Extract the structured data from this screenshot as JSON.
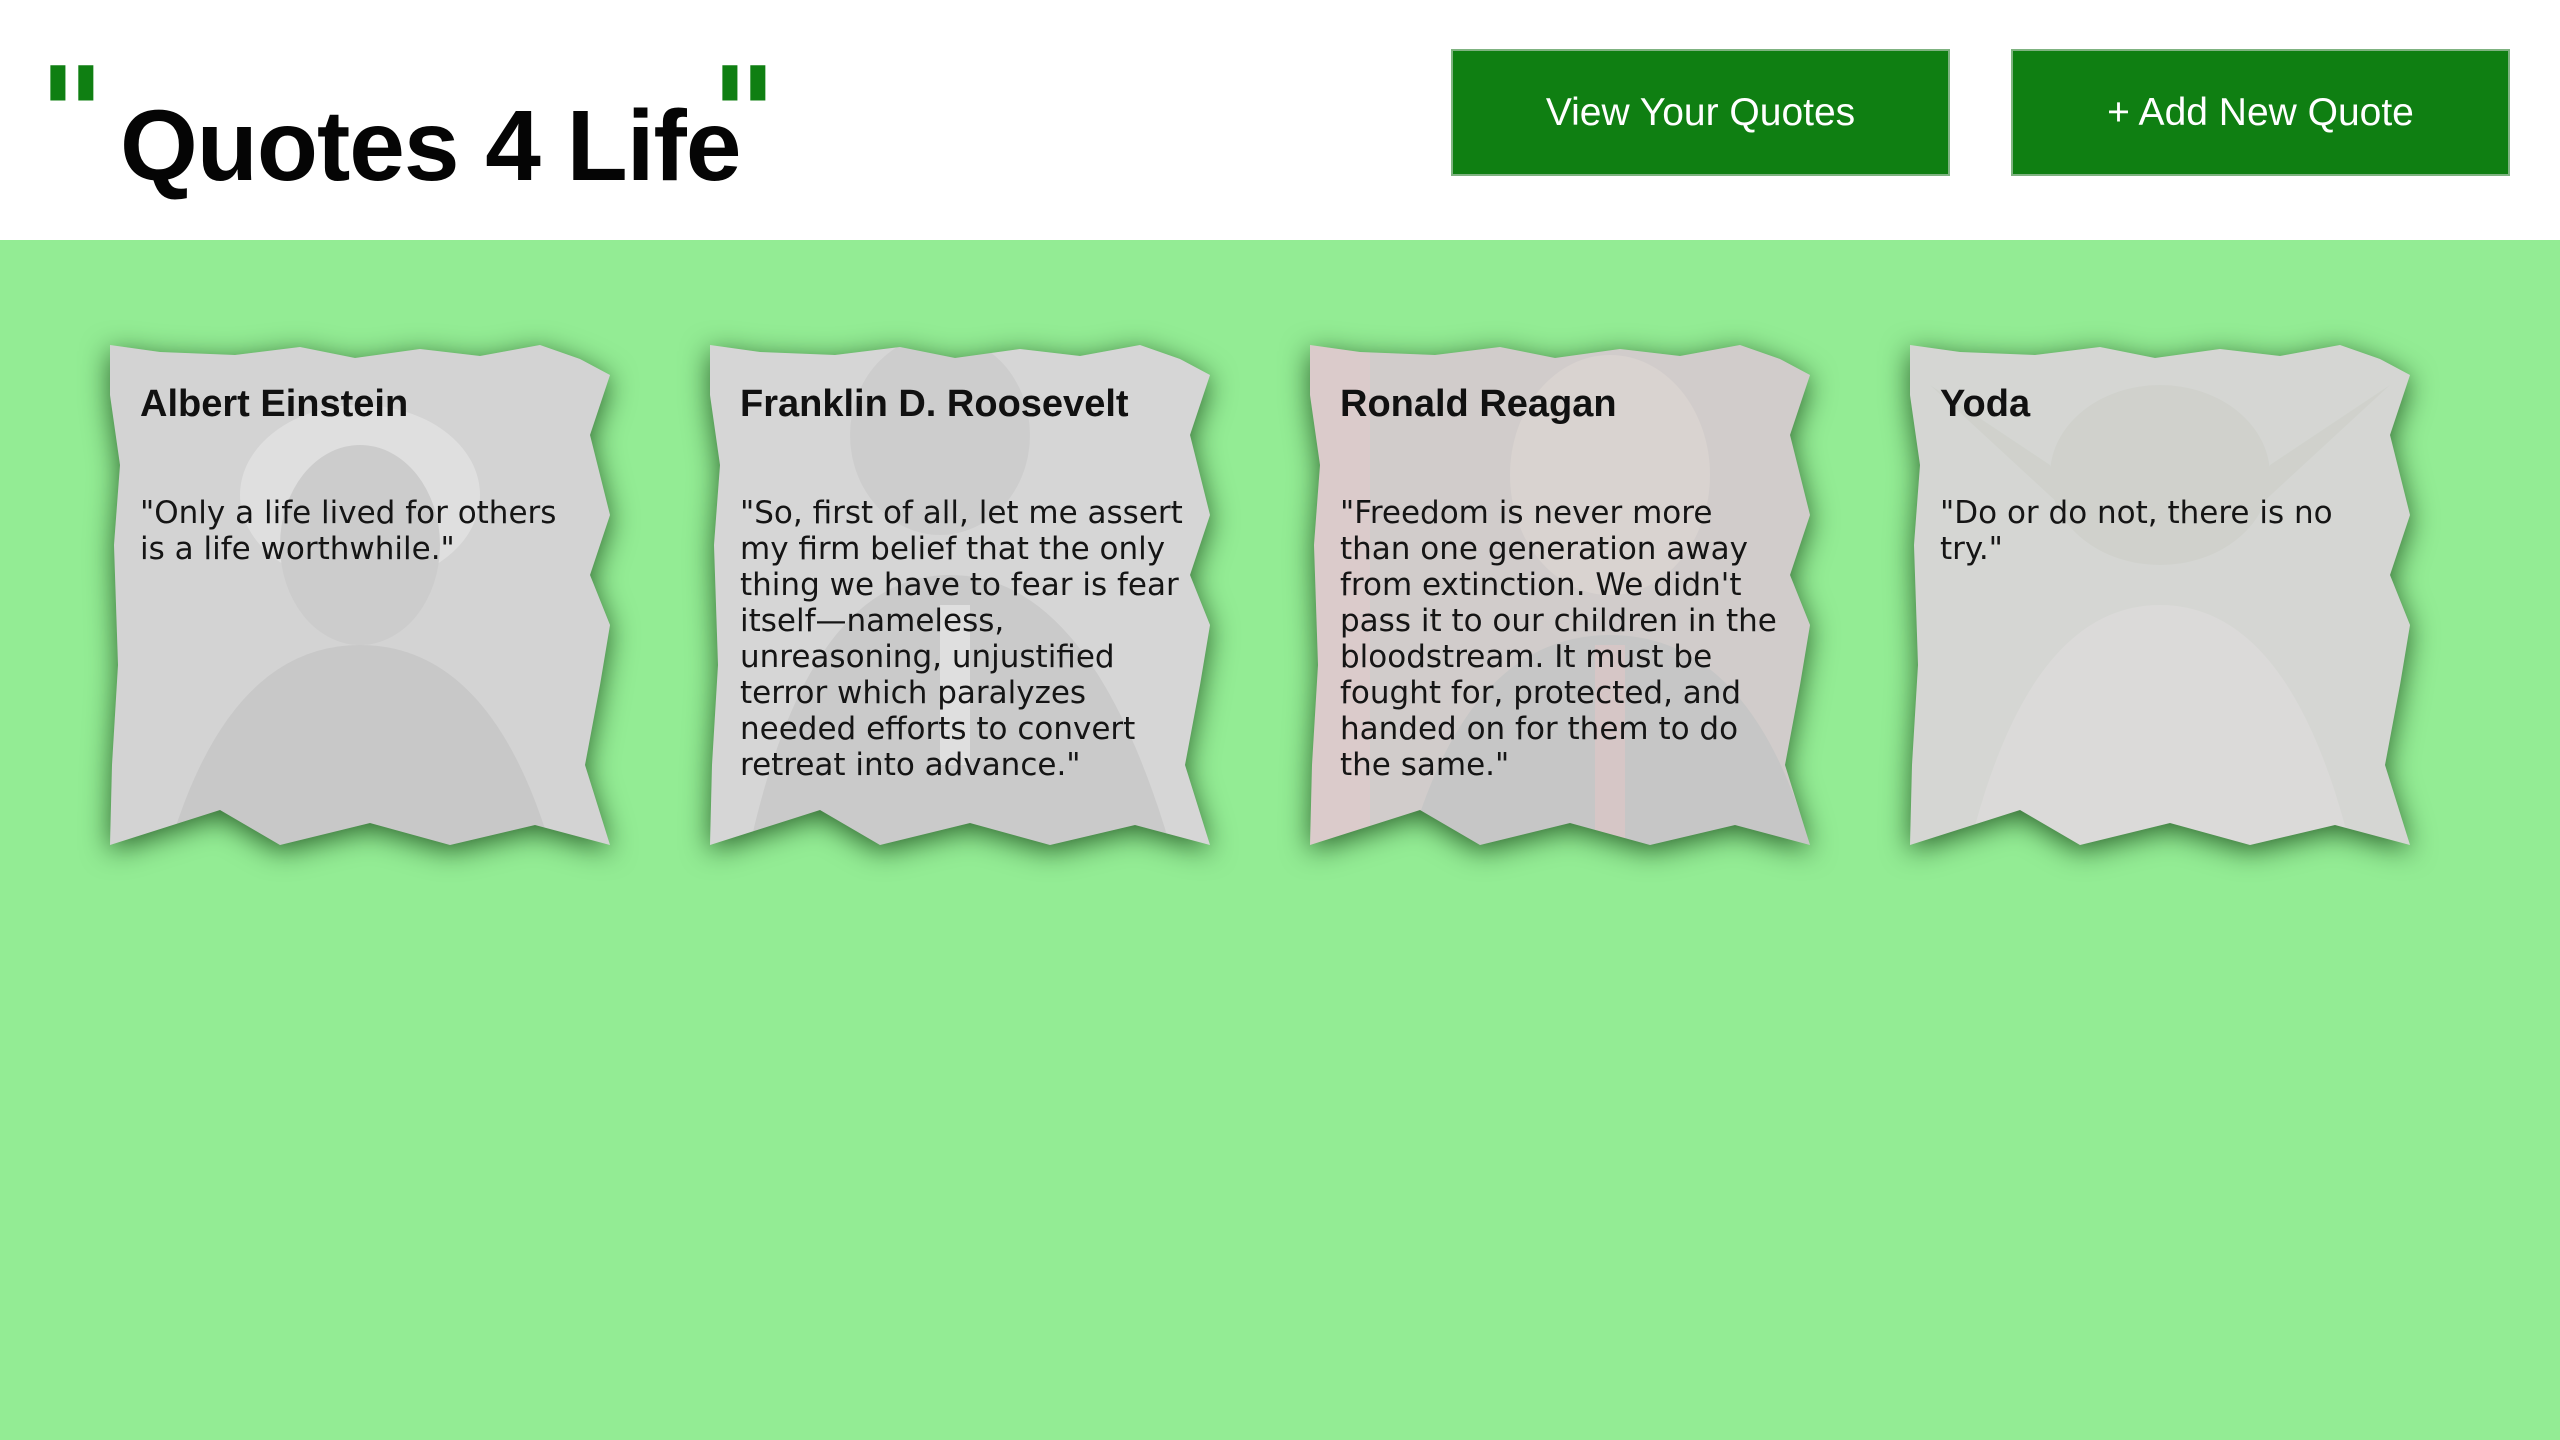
{
  "header": {
    "logo_open_mark": "\"",
    "logo_title": "Quotes 4 Life",
    "logo_close_mark": "\"",
    "view_button_label": "View Your Quotes",
    "add_button_label": "+ Add New Quote"
  },
  "quotes": [
    {
      "name": "Albert Einstein",
      "text": "\"Only a life lived for others is a life worthwhile.\"",
      "portrait_icon": "einstein-portrait"
    },
    {
      "name": "Franklin D. Roosevelt",
      "text": "\"So, first of all, let me assert my firm belief that the only thing we have to fear is fear itself—nameless, unreasoning, unjustified terror which paralyzes needed efforts to convert retreat into advance.\"",
      "portrait_icon": "roosevelt-portrait"
    },
    {
      "name": "Ronald Reagan",
      "text": "\"Freedom is never more than one generation away from extinction. We didn't pass it to our children in the bloodstream. It must be fought for, protected, and handed on for them to do the same.\"",
      "portrait_icon": "reagan-portrait"
    },
    {
      "name": "Yoda",
      "text": "\"Do or do not, there is no try.\"",
      "portrait_icon": "yoda-portrait"
    }
  ],
  "colors": {
    "brand_green": "#0f7f12",
    "background_green": "#93ec94",
    "card_gray": "#dcdcdc"
  }
}
